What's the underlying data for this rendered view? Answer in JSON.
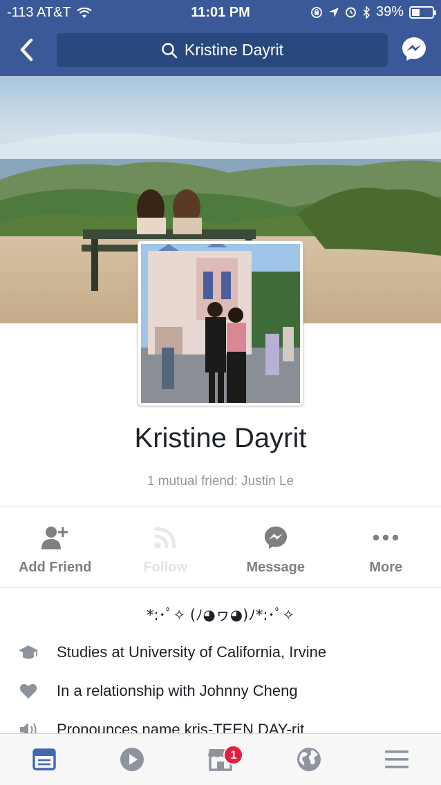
{
  "status_bar": {
    "carrier": "-113 AT&T",
    "time": "11:01 PM",
    "battery": "39%",
    "battery_level": 0.39
  },
  "nav": {
    "search_text": "Kristine Dayrit",
    "icons": [
      "back-chevron-icon",
      "search-icon",
      "messenger-icon"
    ]
  },
  "profile": {
    "name": "Kristine Dayrit",
    "mutual_friends": "1 mutual friend: Justin Le",
    "bio": "*:･ﾟ✧ (ﾉ◕ヮ◕)ﾉ*:･ﾟ✧"
  },
  "actions": [
    {
      "label": "Add Friend",
      "icon": "add-friend-icon",
      "enabled": true
    },
    {
      "label": "Follow",
      "icon": "follow-icon",
      "enabled": false
    },
    {
      "label": "Message",
      "icon": "messenger-icon",
      "enabled": true
    },
    {
      "label": "More",
      "icon": "more-icon",
      "enabled": true
    }
  ],
  "info": [
    {
      "text": "Studies at University of California, Irvine",
      "icon": "graduation-cap-icon"
    },
    {
      "text": "In a relationship with Johnny Cheng",
      "icon": "heart-icon"
    },
    {
      "text": "Pronounces name kris-TEEN DAY-rit",
      "icon": "speaker-icon"
    }
  ],
  "tabs": [
    {
      "name": "news-feed",
      "icon": "news-feed-icon",
      "active": true
    },
    {
      "name": "video",
      "icon": "video-play-icon",
      "active": false
    },
    {
      "name": "marketplace",
      "icon": "marketplace-icon",
      "active": false,
      "badge": "1"
    },
    {
      "name": "notifications",
      "icon": "globe-icon",
      "active": false
    },
    {
      "name": "menu",
      "icon": "menu-icon",
      "active": false
    }
  ],
  "colors": {
    "brand": "#3b5998",
    "search_bg": "#29487d",
    "badge": "#e41e3f",
    "active_tab": "#4267b2",
    "inactive_icon": "#7f7f7f"
  }
}
